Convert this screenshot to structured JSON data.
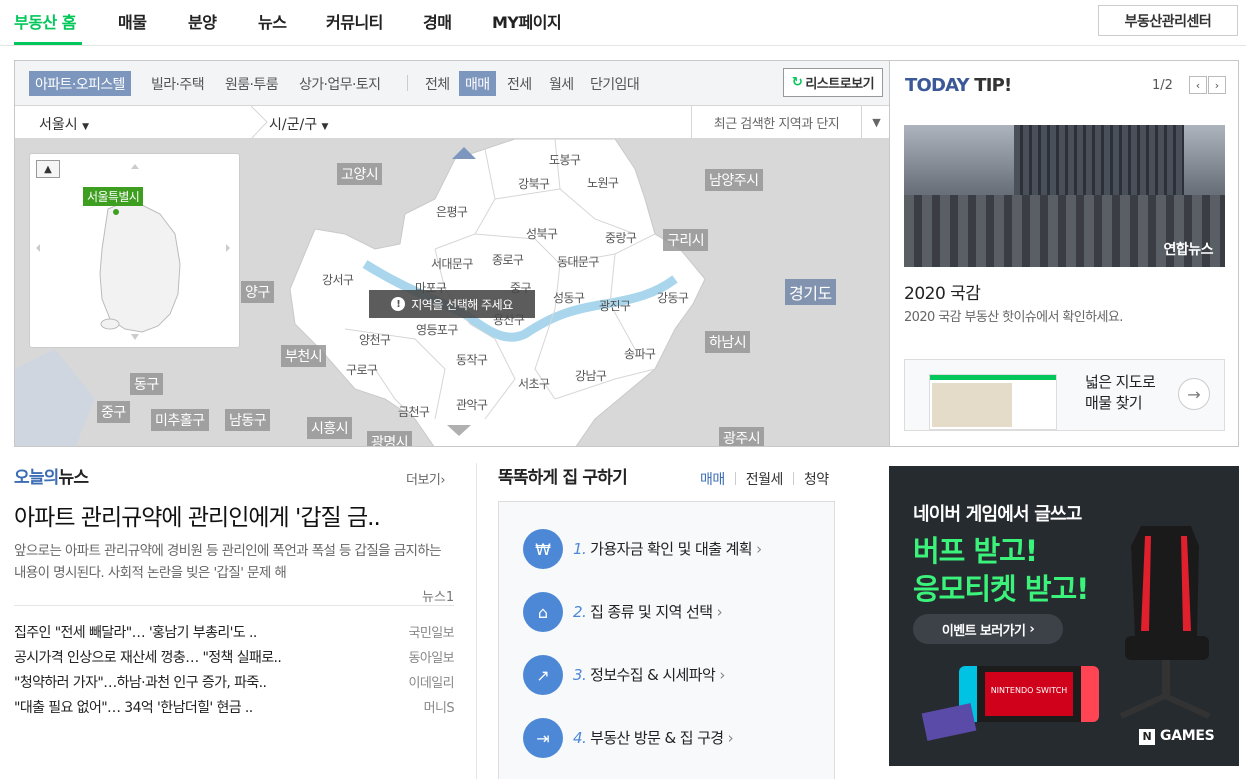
{
  "nav": {
    "items": [
      "부동산 홈",
      "매물",
      "분양",
      "뉴스",
      "커뮤니티",
      "경매",
      "MY페이지"
    ],
    "manage_btn": "부동산관리센터"
  },
  "map": {
    "type_tabs": [
      "아파트·오피스텔",
      "빌라·주택",
      "원룸·투룸",
      "상가·업무·토지"
    ],
    "deal_tabs": [
      "전체",
      "매매",
      "전세",
      "월세",
      "단기임대"
    ],
    "list_btn": "리스트로보기",
    "city": "서울시",
    "district": "시/군/구",
    "recent_search": "최근 검색한 지역과 단지",
    "tooltip": "지역을 선택해 주세요",
    "minimap_label": "서울특별시",
    "gray_labels": [
      "고양시",
      "남양주시",
      "구리시",
      "경기도",
      "하남시",
      "부천시",
      "동구",
      "중구",
      "미추홀구",
      "남동구",
      "시흥시",
      "광명시",
      "광주시",
      "양구"
    ],
    "districts": [
      "도봉구",
      "강북구",
      "노원구",
      "은평구",
      "성북구",
      "중랑구",
      "서대문구",
      "종로구",
      "동대문구",
      "강서구",
      "마포구",
      "중구",
      "성동구",
      "광진구",
      "강동구",
      "양천구",
      "영등포구",
      "용산구",
      "구로구",
      "동작구",
      "송파구",
      "서초구",
      "강남구",
      "금천구",
      "관악구"
    ]
  },
  "tip": {
    "title_a": "TODAY",
    "title_b": "TIP!",
    "page": "1/2",
    "photo_logo": "연합뉴스",
    "headline": "2020 국감",
    "desc": "2020 국감 부동산 핫이슈에서 확인하세요.",
    "banner_line1": "넓은 지도로",
    "banner_line2": "매물 찾기"
  },
  "news": {
    "head_a": "오늘의",
    "head_b": "뉴스",
    "more": "더보기",
    "title": "아파트 관리규약에 관리인에게 '갑질 금..",
    "desc": "앞으로는 아파트 관리규약에 경비원 등 관리인에 폭언과 폭설 등 갑질을 금지하는 내용이 명시된다. 사회적 논란을 빚은 '갑질' 문제 해",
    "source": "뉴스1",
    "items": [
      {
        "title": "집주인 \"전세 빼달라\"… '홍남기 부총리'도 ..",
        "source": "국민일보"
      },
      {
        "title": "공시가격 인상으로 재산세 껑충… \"정책 실패로..",
        "source": "동아일보"
      },
      {
        "title": "\"청약하러 가자\"…하남·과천 인구 증가, 파죽..",
        "source": "이데일리"
      },
      {
        "title": "\"대출 필요 없어\"… 34억 '한남더힐' 현금 ..",
        "source": "머니S"
      }
    ]
  },
  "guide": {
    "title": "똑똑하게 집 구하기",
    "tabs": [
      "매매",
      "전월세",
      "청약"
    ],
    "steps": [
      {
        "num": "1.",
        "label": "가용자금 확인 및 대출 계획",
        "icon": "₩"
      },
      {
        "num": "2.",
        "label": "집 종류 및 지역 선택",
        "icon": "⌂"
      },
      {
        "num": "3.",
        "label": "정보수집 & 시세파악",
        "icon": "↗"
      },
      {
        "num": "4.",
        "label": "부동산 방문 & 집 구경",
        "icon": "⇥"
      }
    ]
  },
  "ad": {
    "line1": "네이버 게임에서 글쓰고",
    "line2": "버프 받고!",
    "line3": "응모티켓 받고!",
    "button": "이벤트 보러가기",
    "switch_text": "NINTENDO SWITCH",
    "brand": "GAMES",
    "brand_box": "N"
  }
}
